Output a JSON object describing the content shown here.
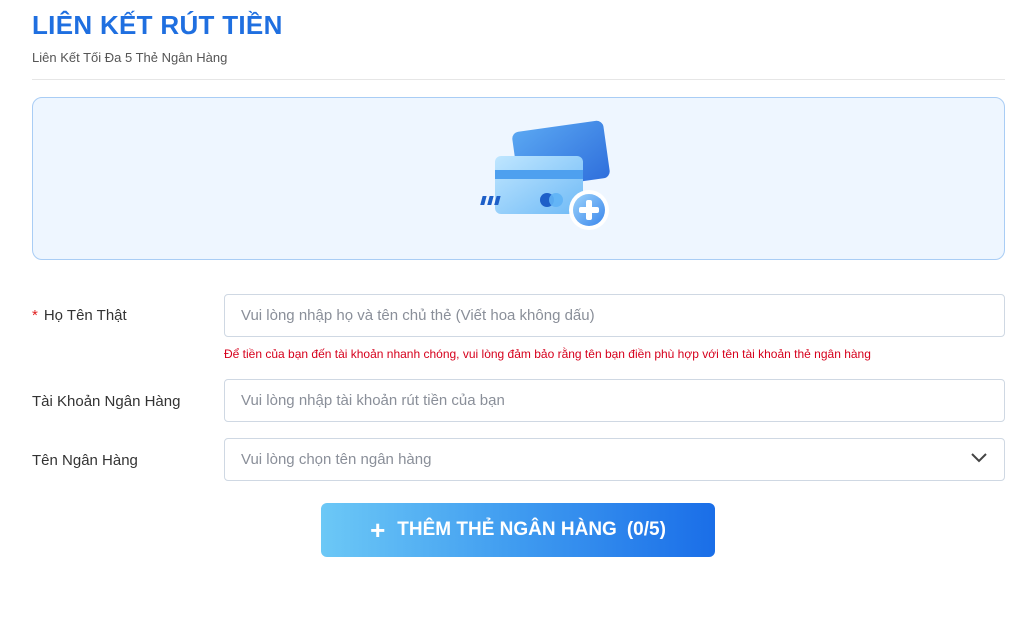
{
  "header": {
    "title": "LIÊN KẾT RÚT TIỀN",
    "subtitle": "Liên Kết Tối Đa 5 Thẻ Ngân Hàng"
  },
  "card_panel": {
    "icon": "credit-card-add-icon"
  },
  "form": {
    "name": {
      "required_mark": "*",
      "label": "Họ Tên Thật",
      "placeholder": "Vui lòng nhập họ và tên chủ thẻ (Viết hoa không dấu)",
      "hint": "Để tiền của bạn đến tài khoản nhanh chóng, vui lòng đảm bảo rằng tên bạn điền phù hợp với tên tài khoản thẻ ngân hàng"
    },
    "account": {
      "label": "Tài Khoản Ngân Hàng",
      "placeholder": "Vui lòng nhập tài khoản rút tiền của bạn"
    },
    "bank": {
      "label": "Tên Ngân Hàng",
      "placeholder": "Vui lòng chọn tên ngân hàng",
      "icon": "chevron-down-icon"
    }
  },
  "add_button": {
    "icon": "plus-icon",
    "label": "THÊM THẺ NGÂN HÀNG",
    "count": "(0/5)"
  },
  "colors": {
    "title": "#1f6fe0",
    "panel_bg": "#eef6ff",
    "panel_border": "#a9cdf5",
    "hint": "#d6001c",
    "button_start": "#6cc8f6",
    "button_end": "#1a6ee8"
  }
}
